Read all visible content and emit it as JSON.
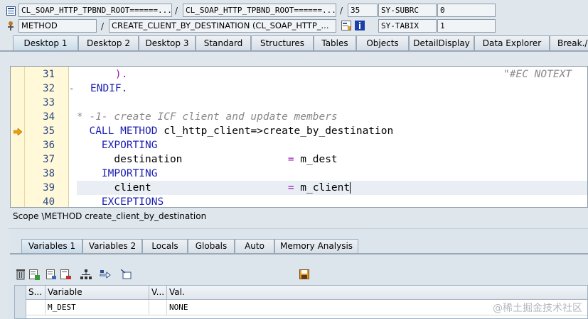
{
  "status": {
    "row1": {
      "program": "CL_SOAP_HTTP_TPBND_ROOT======...",
      "include": "CL_SOAP_HTTP_TPBND_ROOT======...",
      "line": "35",
      "sysfield_label": "SY-SUBRC",
      "sysfield_value": "0"
    },
    "row2": {
      "event_type": "METHOD",
      "event": "CREATE_CLIENT_BY_DESTINATION (CL_SOAP_HTTP_...",
      "sysfield_label": "SY-TABIX",
      "sysfield_value": "1"
    },
    "separator": "/"
  },
  "desktop_tabs": [
    "Desktop 1",
    "Desktop 2",
    "Desktop 3",
    "Standard",
    "Structures",
    "Tables",
    "Objects",
    "DetailDisplay",
    "Data Explorer",
    "Break./Watchpoints"
  ],
  "code": {
    "lines": [
      {
        "n": "31",
        "parts": [
          {
            "t": "    ",
            "c": ""
          },
          {
            "t": ").",
            "c": "op"
          }
        ]
      },
      {
        "n": "32",
        "parts": [
          {
            "t": "ENDIF.",
            "c": "kw"
          }
        ]
      },
      {
        "n": "33",
        "parts": []
      },
      {
        "n": "34",
        "parts": [
          {
            "t": "* -1- create ICF client and update members",
            "c": "cm"
          }
        ]
      },
      {
        "n": "35",
        "parts": [
          {
            "t": "  ",
            "c": ""
          },
          {
            "t": "CALL METHOD",
            "c": "kw"
          },
          {
            "t": " cl_http_client=>create_by_destination",
            "c": ""
          }
        ]
      },
      {
        "n": "36",
        "parts": [
          {
            "t": "    ",
            "c": ""
          },
          {
            "t": "EXPORTING",
            "c": "kw"
          }
        ]
      },
      {
        "n": "37",
        "parts": [
          {
            "t": "      destination                 ",
            "c": ""
          },
          {
            "t": "=",
            "c": "op"
          },
          {
            "t": " m_dest",
            "c": ""
          }
        ]
      },
      {
        "n": "38",
        "parts": [
          {
            "t": "    ",
            "c": ""
          },
          {
            "t": "IMPORTING",
            "c": "kw"
          }
        ]
      },
      {
        "n": "39",
        "parts": [
          {
            "t": "      client                      ",
            "c": ""
          },
          {
            "t": "=",
            "c": "op"
          },
          {
            "t": " m_client",
            "c": ""
          }
        ]
      },
      {
        "n": "40",
        "parts": [
          {
            "t": "    ",
            "c": ""
          },
          {
            "t": "EXCEPTIONS",
            "c": "kw"
          }
        ]
      }
    ],
    "line31_comment": "\"#EC NOTEXT"
  },
  "scope_text": "Scope \\METHOD create_client_by_destination",
  "variable_tabs": [
    "Variables 1",
    "Variables 2",
    "Locals",
    "Globals",
    "Auto",
    "Memory Analysis"
  ],
  "grid": {
    "headers": [
      "S...",
      "Variable",
      "V...",
      "Val."
    ],
    "rows": [
      {
        "variable": "M_DEST",
        "value": "NONE"
      }
    ]
  },
  "watermark": "@稀土掘金技术社区",
  "colors": {
    "keyword": "#1d1fb3",
    "comment": "#8a8a8a",
    "operator": "#9b1bb5",
    "line_number": "#2c4a86",
    "execution_arrow": "#f0a000"
  }
}
